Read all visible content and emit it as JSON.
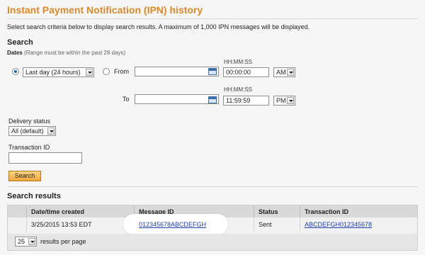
{
  "page": {
    "title": "Instant Payment Notification (IPN) history",
    "intro": "Select search criteria below to display search results. A maximum of 1,000 IPN messages will be displayed."
  },
  "search": {
    "heading": "Search",
    "dates_label": "Dates",
    "dates_hint": "(Range must be within the past 28 days)",
    "range_option": "Last day (24 hours)",
    "from_label": "From",
    "to_label": "To",
    "time_format_label": "HH:MM:SS",
    "from_time": "00:00:00",
    "from_ampm": "AM",
    "to_time": "11:59:59",
    "to_ampm": "PM",
    "delivery_status_label": "Delivery status",
    "delivery_status_value": "All (default)",
    "transaction_id_label": "Transaction ID",
    "search_button": "Search"
  },
  "results": {
    "heading": "Search results",
    "columns": [
      "Date/time created",
      "Message ID",
      "Status",
      "Transaction ID"
    ],
    "rows": [
      {
        "date_time": "3/25/2015 13:53 EDT",
        "message_id": "012345678ABCDEFGH",
        "status": "Sent",
        "transaction_id": "ABCDEFGH012345678"
      }
    ],
    "per_page_value": "25",
    "per_page_label": "results per page"
  }
}
